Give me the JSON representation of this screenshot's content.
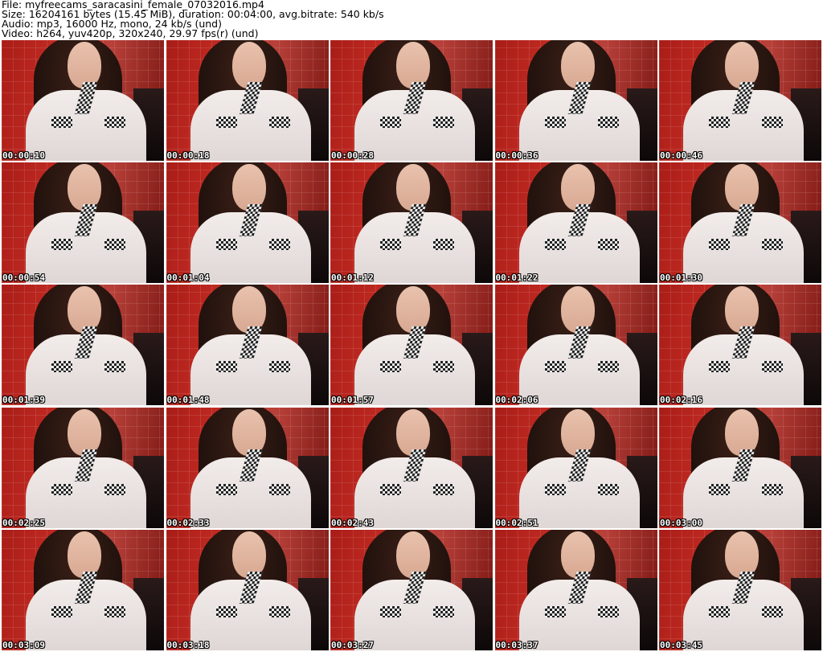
{
  "header": {
    "file_line": "File: myfreecams_saracasini_female_07032016.mp4",
    "size_line": "Size: 16204161 bytes (15.45 MiB), duration: 00:04:00, avg.bitrate: 540 kb/s",
    "audio_line": "Audio: mp3, 16000 Hz, mono, 24 kb/s (und)",
    "video_line": "Video: h264, yuv420p, 320x240, 29.97 fps(r) (und)"
  },
  "thumbnails": [
    {
      "timestamp": "00:00:10"
    },
    {
      "timestamp": "00:00:18"
    },
    {
      "timestamp": "00:00:28"
    },
    {
      "timestamp": "00:00:36"
    },
    {
      "timestamp": "00:00:46"
    },
    {
      "timestamp": "00:00:54"
    },
    {
      "timestamp": "00:01:04"
    },
    {
      "timestamp": "00:01:12"
    },
    {
      "timestamp": "00:01:22"
    },
    {
      "timestamp": "00:01:30"
    },
    {
      "timestamp": "00:01:39"
    },
    {
      "timestamp": "00:01:48"
    },
    {
      "timestamp": "00:01:57"
    },
    {
      "timestamp": "00:02:06"
    },
    {
      "timestamp": "00:02:16"
    },
    {
      "timestamp": "00:02:25"
    },
    {
      "timestamp": "00:02:33"
    },
    {
      "timestamp": "00:02:43"
    },
    {
      "timestamp": "00:02:51"
    },
    {
      "timestamp": "00:03:00"
    },
    {
      "timestamp": "00:03:09"
    },
    {
      "timestamp": "00:03:18"
    },
    {
      "timestamp": "00:03:27"
    },
    {
      "timestamp": "00:03:37"
    },
    {
      "timestamp": "00:03:45"
    }
  ]
}
